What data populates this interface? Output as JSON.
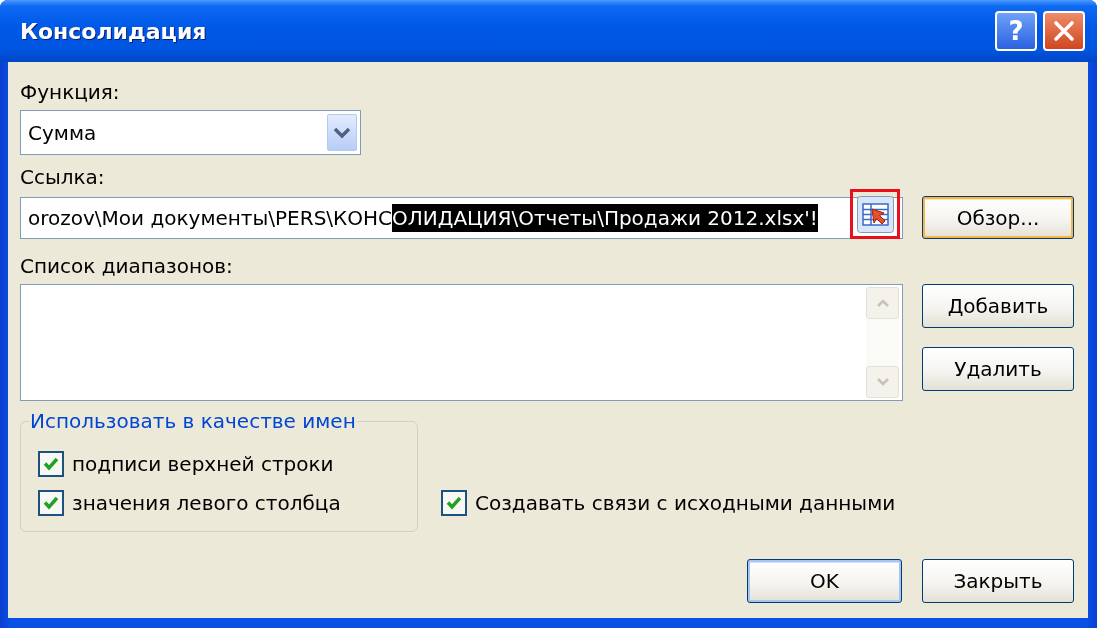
{
  "window": {
    "title": "Консолидация",
    "title_buttons": [
      {
        "kind": "help",
        "label": "?"
      },
      {
        "kind": "close"
      }
    ]
  },
  "function": {
    "label": "Функция:",
    "value": "Сумма"
  },
  "reference": {
    "label": "Ссылка:",
    "value_parts": [
      {
        "text": "orozov\\Мои документы\\PERS\\КОНС",
        "selected": false
      },
      {
        "text": "ОЛИДАЦИЯ\\Отчеты\\Продажи 2012.xlsx'!",
        "selected": true
      }
    ],
    "range_button": {
      "highlighted": true
    }
  },
  "browse_button": {
    "label": "Обзор...",
    "hot": true
  },
  "ranges": {
    "label": "Список диапазонов:"
  },
  "range_buttons": [
    {
      "label": "Добавить"
    },
    {
      "label": "Удалить"
    }
  ],
  "use_labels": {
    "title": "Использовать в качестве имен",
    "options": [
      {
        "label": "подписи верхней строки",
        "checked": true
      },
      {
        "label": "значения левого столбца",
        "checked": true
      }
    ]
  },
  "link_to_source": {
    "label": "Создавать связи с исходными данными",
    "checked": true
  },
  "footer_buttons": [
    {
      "label": "OK",
      "default": true
    },
    {
      "label": "Закрыть",
      "default": false
    }
  ]
}
